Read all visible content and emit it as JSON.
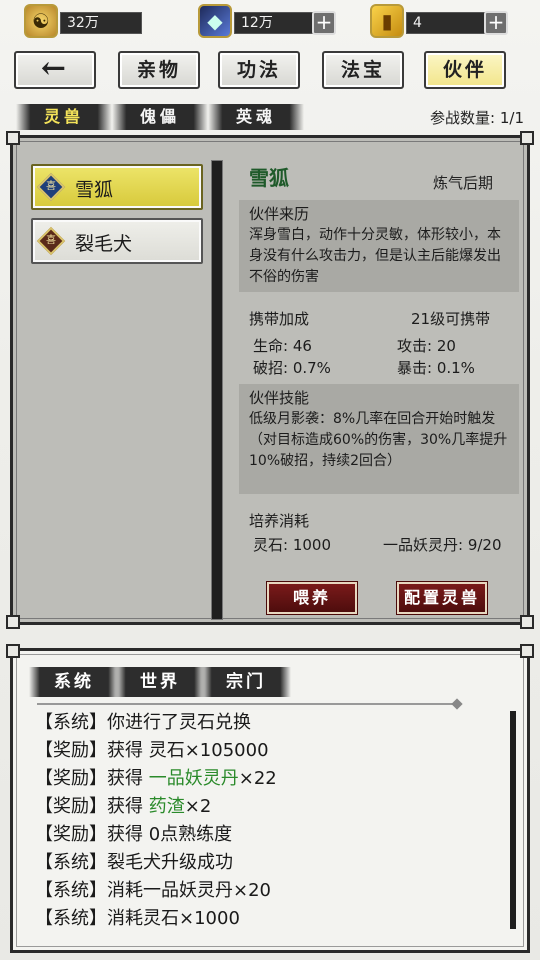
{
  "currency": {
    "coins": {
      "value": "32万",
      "icon": "coin-icon"
    },
    "spirit_crystal": {
      "value": "12万",
      "icon": "crystal-icon"
    },
    "gold_ticket": {
      "value": "4",
      "icon": "gold-ingot-icon"
    }
  },
  "nav": {
    "back_label": "←",
    "items": [
      {
        "label": "亲物"
      },
      {
        "label": "功法"
      },
      {
        "label": "法宝"
      },
      {
        "label": "伙伴"
      }
    ]
  },
  "subtabs": [
    {
      "label": "灵兽"
    },
    {
      "label": "傀儡"
    },
    {
      "label": "英魂"
    }
  ],
  "battle_count": "参战数量: 1/1",
  "pets": [
    {
      "name": "雪狐",
      "icon_text": "喜"
    },
    {
      "name": "裂毛犬",
      "icon_text": "喜"
    }
  ],
  "detail": {
    "name": "雪狐",
    "realm": "炼气后期",
    "origin_title": "伙伴来历",
    "origin_text": "浑身雪白，动作十分灵敏，体形较小，本身没有什么攻击力，但是认主后能爆发出不俗的伤害",
    "bonus_title": "携带加成",
    "bonus_req": "21级可携带",
    "stats": {
      "hp": "生命: 46",
      "atk": "攻击: 20",
      "pierce": "破招: 0.7%",
      "crit": "暴击: 0.1%"
    },
    "skill_title": "伙伴技能",
    "skill_text": "低级月影袭：8%几率在回合开始时触发（对目标造成60%的伤害，30%几率提升10%破招，持续2回合）",
    "cost_title": "培养消耗",
    "cost_stone": "灵石: 1000",
    "cost_pill": "一品妖灵丹: 9/20",
    "feed_label": "喂养",
    "config_label": "配置灵兽"
  },
  "chat": {
    "tabs": [
      {
        "label": "系统"
      },
      {
        "label": "世界"
      },
      {
        "label": "宗门"
      }
    ],
    "lines": [
      {
        "prefix": "【系统】",
        "text": "你进行了灵石兑换",
        "highlight": "",
        "suffix": ""
      },
      {
        "prefix": "【奖励】",
        "text": "获得 灵石×105000",
        "highlight": "",
        "suffix": ""
      },
      {
        "prefix": "【奖励】",
        "text": "获得 ",
        "highlight": "一品妖灵丹",
        "suffix": "×22"
      },
      {
        "prefix": "【奖励】",
        "text": "获得 ",
        "highlight": "药渣",
        "suffix": "×2"
      },
      {
        "prefix": "【奖励】",
        "text": "获得 0点熟练度",
        "highlight": "",
        "suffix": ""
      },
      {
        "prefix": "【系统】",
        "text": "裂毛犬升级成功",
        "highlight": "",
        "suffix": ""
      },
      {
        "prefix": "【系统】",
        "text": "消耗一品妖灵丹×20",
        "highlight": "",
        "suffix": ""
      },
      {
        "prefix": "【系统】",
        "text": "消耗灵石×1000",
        "highlight": "",
        "suffix": ""
      }
    ]
  },
  "colors": {
    "accent_green": "#2a8a2a",
    "active_tab_yellow": "#f5e45a",
    "button_red": "#7a1a1a"
  }
}
